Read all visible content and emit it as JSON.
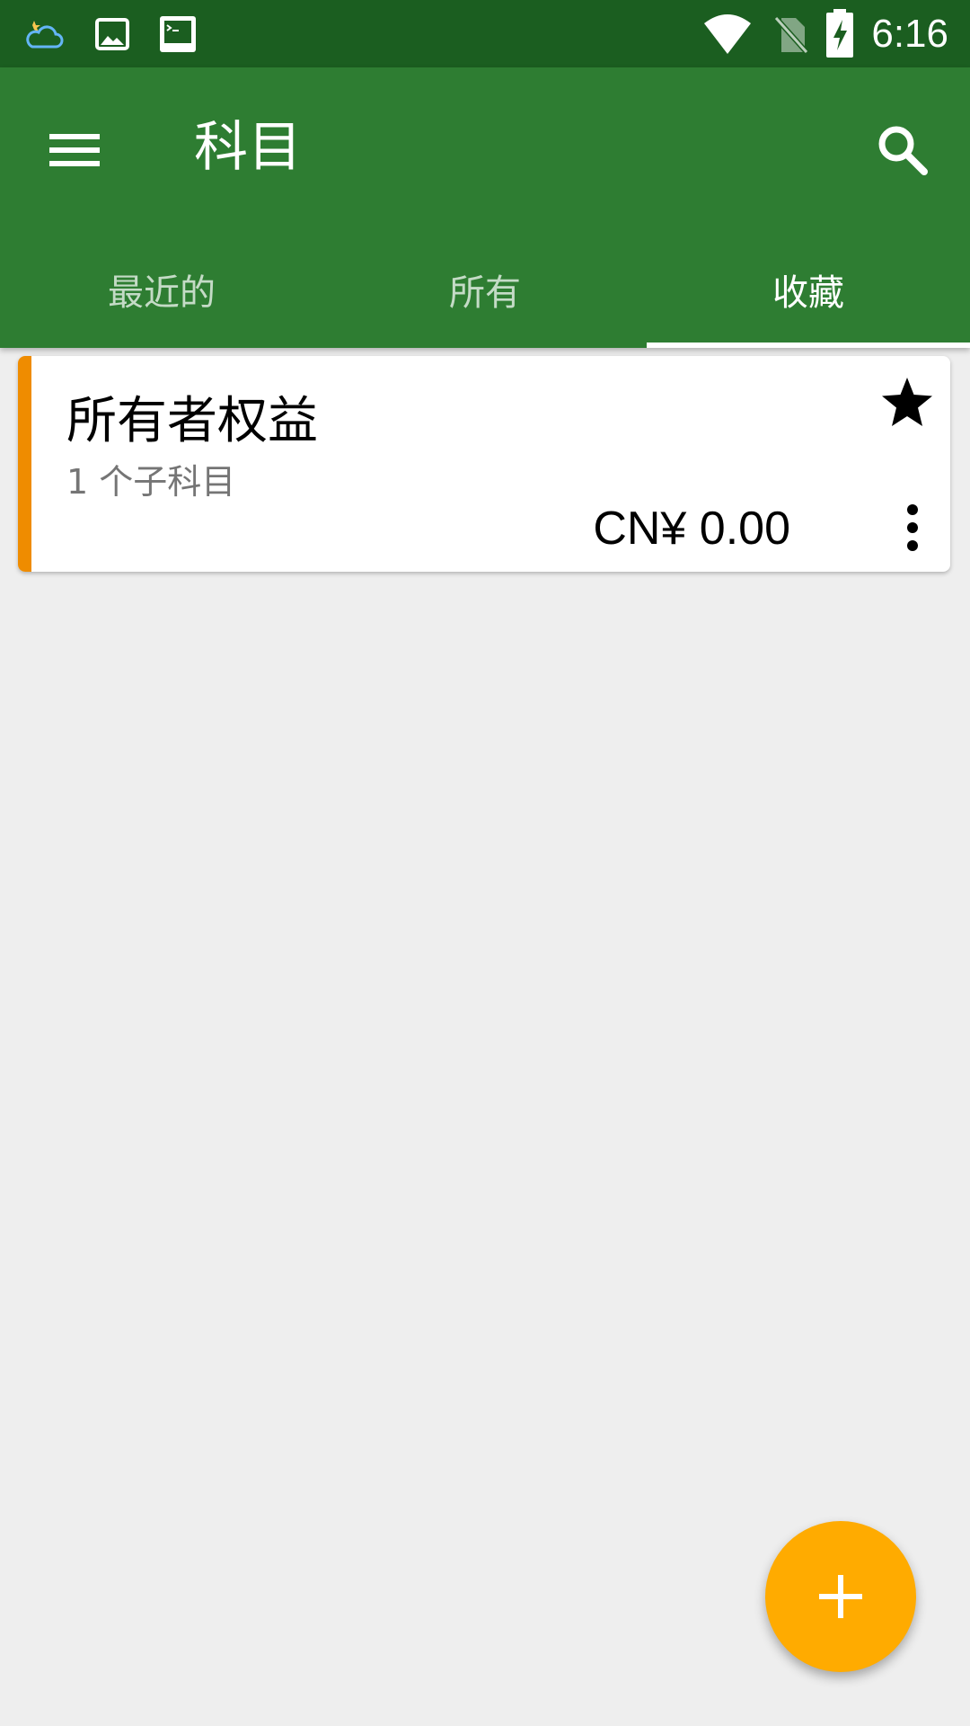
{
  "status_bar": {
    "time": "6:16",
    "left_icons": [
      "weather-icon",
      "image-icon",
      "terminal-icon"
    ],
    "right_icons": [
      "wifi-icon",
      "no-sim-icon",
      "battery-charging-icon"
    ]
  },
  "app_bar": {
    "title": "科目",
    "menu_icon": "menu-icon",
    "search_icon": "search-icon",
    "color": "#2e7d32"
  },
  "tabs": [
    {
      "label": "最近的",
      "active": false
    },
    {
      "label": "所有",
      "active": false
    },
    {
      "label": "收藏",
      "active": true
    }
  ],
  "accounts": [
    {
      "name": "所有者权益",
      "subaccounts": "1 个子科目",
      "balance": "CN¥ 0.00",
      "color": "#ef8c00",
      "favorite": true
    }
  ],
  "fab": {
    "icon": "plus-icon",
    "color": "#ffab00"
  }
}
